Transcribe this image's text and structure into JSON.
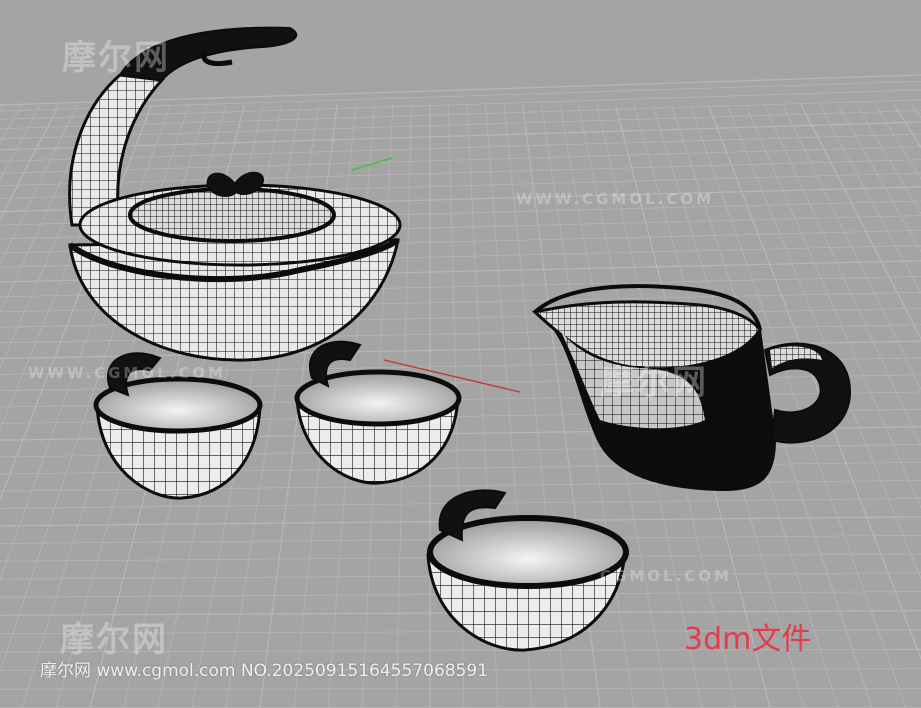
{
  "viewport": {
    "background_color": "#a4a4a4",
    "grid_color": "#b8b8b8",
    "axis_x_color": "#c83232",
    "axis_y_color": "#32c832",
    "wire_color": "#111111",
    "surface_color": "#e8e8e8"
  },
  "watermarks": {
    "brand_cn": "摩尔网",
    "brand_en": "WWW.CGMOL.COM",
    "brand_en_short": "CGMOL.COM"
  },
  "label": "3dm文件",
  "footer": "摩尔网 www.cgmol.com NO.20250915164557068591",
  "icons": [
    "teapot-model-icon",
    "teacup-model-icon",
    "fair-cup-model-icon"
  ]
}
